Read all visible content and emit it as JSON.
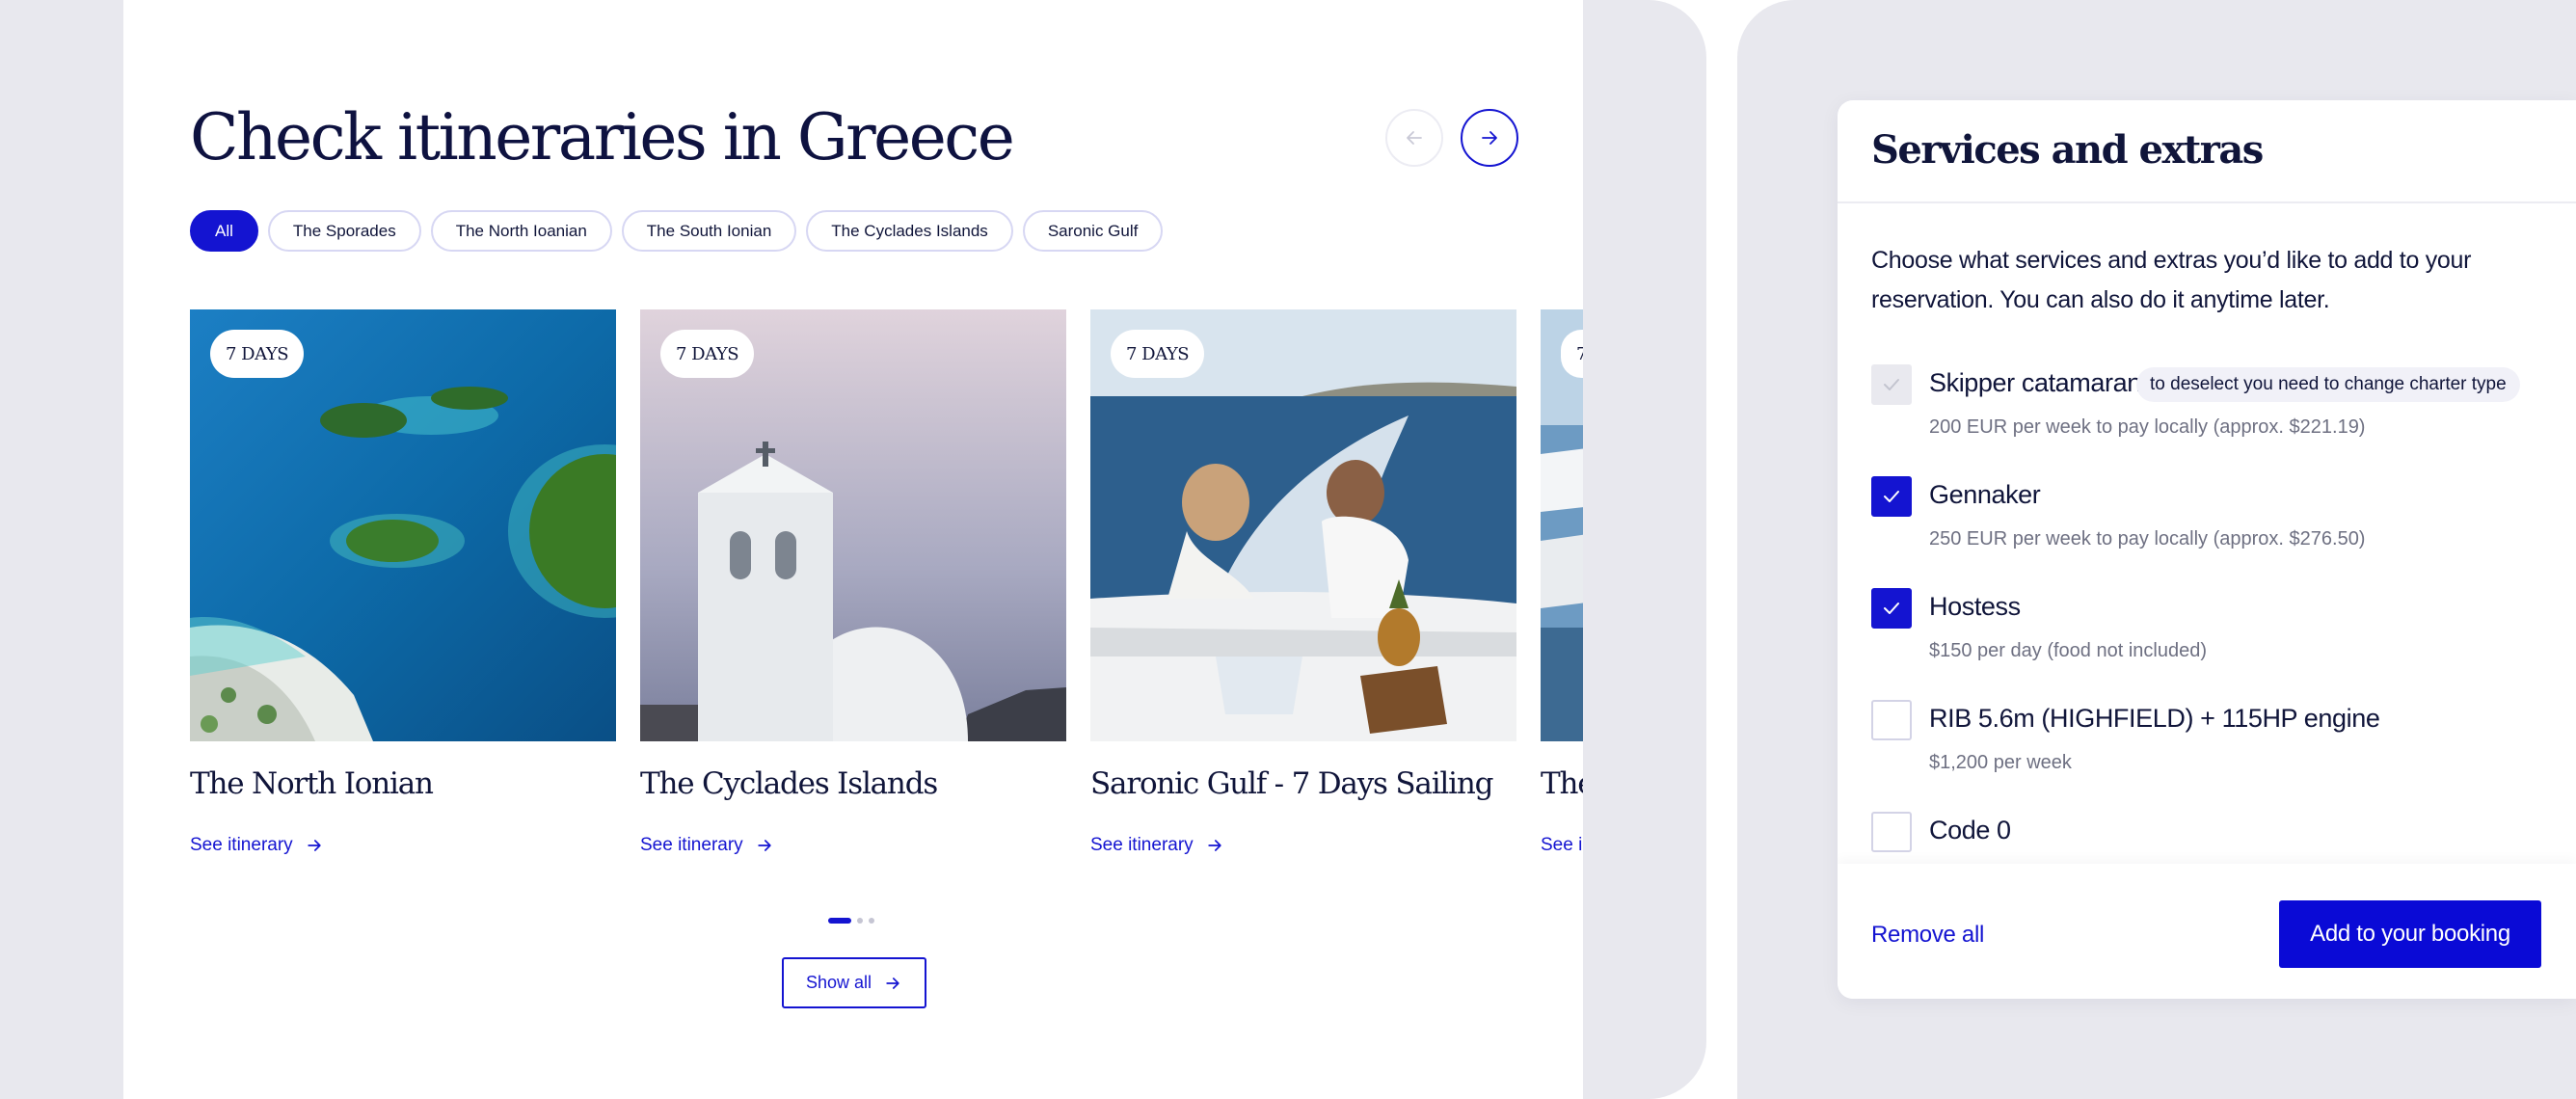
{
  "left_section": {
    "title": "Check itineraries in Greece",
    "nav": {
      "prev_icon": "arrow-left-icon",
      "next_icon": "arrow-right-icon"
    },
    "filters": [
      "All",
      "The Sporades",
      "The North Ioanian",
      "The South Ionian",
      "The Cyclades Islands",
      "Saronic Gulf"
    ],
    "active_filter": "All",
    "cards": [
      {
        "badge": "7 DAYS",
        "title": "The North Ionian",
        "link": "See itinerary"
      },
      {
        "badge": "7 DAYS",
        "title": "The Cyclades Islands",
        "link": "See itinerary"
      },
      {
        "badge": "7 DAYS",
        "title": "Saronic Gulf - 7 Days Sailing",
        "link": "See itinerary"
      },
      {
        "badge": "7",
        "title": "The",
        "link": "See i"
      }
    ],
    "pagination": {
      "pages": 3,
      "current": 1
    },
    "show_all_label": "Show all"
  },
  "modal": {
    "title": "Services and extras",
    "description": "Choose what services and extras you’d like to add to your reservation. You can also do it anytime later.",
    "options": [
      {
        "label": "Skipper catamaran",
        "note": "to deselect you need to change charter type",
        "price": "200 EUR per week to pay locally (approx. $221.19)",
        "state": "disabled"
      },
      {
        "label": "Gennaker",
        "price": "250 EUR per week to pay locally (approx. $276.50)",
        "state": "checked"
      },
      {
        "label": "Hostess",
        "price": "$150 per day (food not included)",
        "state": "checked"
      },
      {
        "label": "RIB 5.6m (HIGHFIELD) + 115HP engine",
        "price": "$1,200 per week",
        "state": "unchecked"
      },
      {
        "label": "Code 0",
        "price": "",
        "state": "unchecked"
      }
    ],
    "remove_all_label": "Remove all",
    "add_button_label": "Add to your booking"
  },
  "colors": {
    "accent": "#1414d1",
    "background_gray": "#e8e8ee",
    "text_dark": "#10153a"
  }
}
